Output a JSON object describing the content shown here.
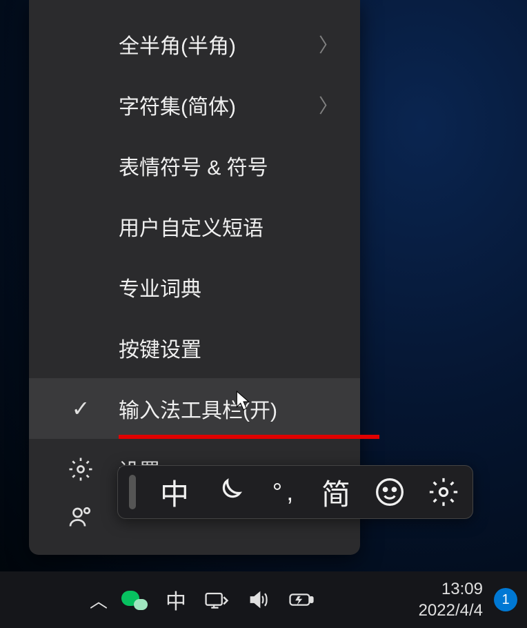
{
  "menu": {
    "items": [
      {
        "label": "全半角(半角)",
        "submenu": true
      },
      {
        "label": "字符集(简体)",
        "submenu": true
      },
      {
        "label": "表情符号 & 符号"
      },
      {
        "label": "用户自定义短语"
      },
      {
        "label": "专业词典"
      },
      {
        "label": "按键设置"
      },
      {
        "label": "输入法工具栏(开)",
        "checked": true,
        "selected": true,
        "underline": true
      },
      {
        "label": "设置",
        "icon": "gear"
      },
      {
        "label": "",
        "icon": "feedback"
      }
    ]
  },
  "ime_toolbar": {
    "buttons": {
      "mode": "中",
      "moon": "moon-icon",
      "punct": "° ,",
      "charset": "简",
      "emoji": "emoji-icon",
      "settings": "gear-icon"
    }
  },
  "taskbar": {
    "ime": "中",
    "time": "13:09",
    "date": "2022/4/4",
    "notif_count": "1"
  }
}
